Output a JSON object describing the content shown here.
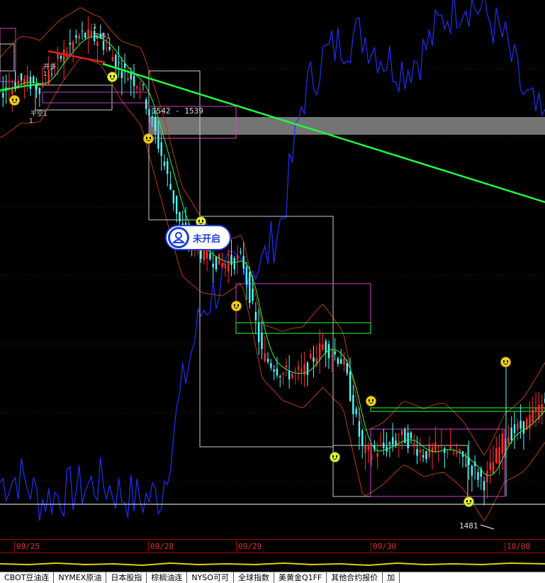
{
  "chart_data": {
    "type": "line",
    "title": "",
    "x_labels": [
      "09/25",
      "09/28",
      "09/29",
      "09/30",
      "10/08"
    ],
    "price_labels": {
      "range_label": "1542 - 1539",
      "low_label": "1481"
    },
    "annotations": [
      "开多",
      "1",
      "平空1",
      "1",
      "平多1",
      "1"
    ],
    "status_badge": "未开启",
    "colors": {
      "up_candle": "#ff3030",
      "down_candle": "#50ffff",
      "moving_average": "#20ff40",
      "trend_line": "#20ff40",
      "bollinger_band": "#b04010",
      "comparison_series": "#2030ff",
      "range_band": "#888888",
      "box_magenta": "#d040d0",
      "box_white": "#cccccc"
    },
    "series": [
      {
        "name": "",
        "role": "price",
        "values": [
          1546,
          1548,
          1547,
          1552,
          1556,
          1555,
          1550,
          1547,
          1535,
          1522,
          1518,
          1516,
          1517,
          1500,
          1497,
          1497,
          1502,
          1499,
          1483,
          1484,
          1486,
          1483,
          1484,
          1482,
          1478,
          1486,
          1488,
          1492
        ]
      },
      {
        "name": "",
        "role": "comparison",
        "values": [
          1478,
          1479,
          1475,
          1476,
          1477,
          1478,
          1476,
          1475,
          1476,
          1494,
          1508,
          1513,
          1516,
          1516,
          1524,
          1545,
          1552,
          1555,
          1556,
          1552,
          1550,
          1553,
          1559,
          1562,
          1560,
          1555,
          1545,
          1540
        ]
      }
    ]
  },
  "tabs": [
    "CBOT豆油连",
    "NYMEX原油",
    "日本股指",
    "棕榈油连",
    "NYSO可可",
    "全球指数",
    "美黄金Q1FF",
    "其他合约报价",
    "加"
  ]
}
